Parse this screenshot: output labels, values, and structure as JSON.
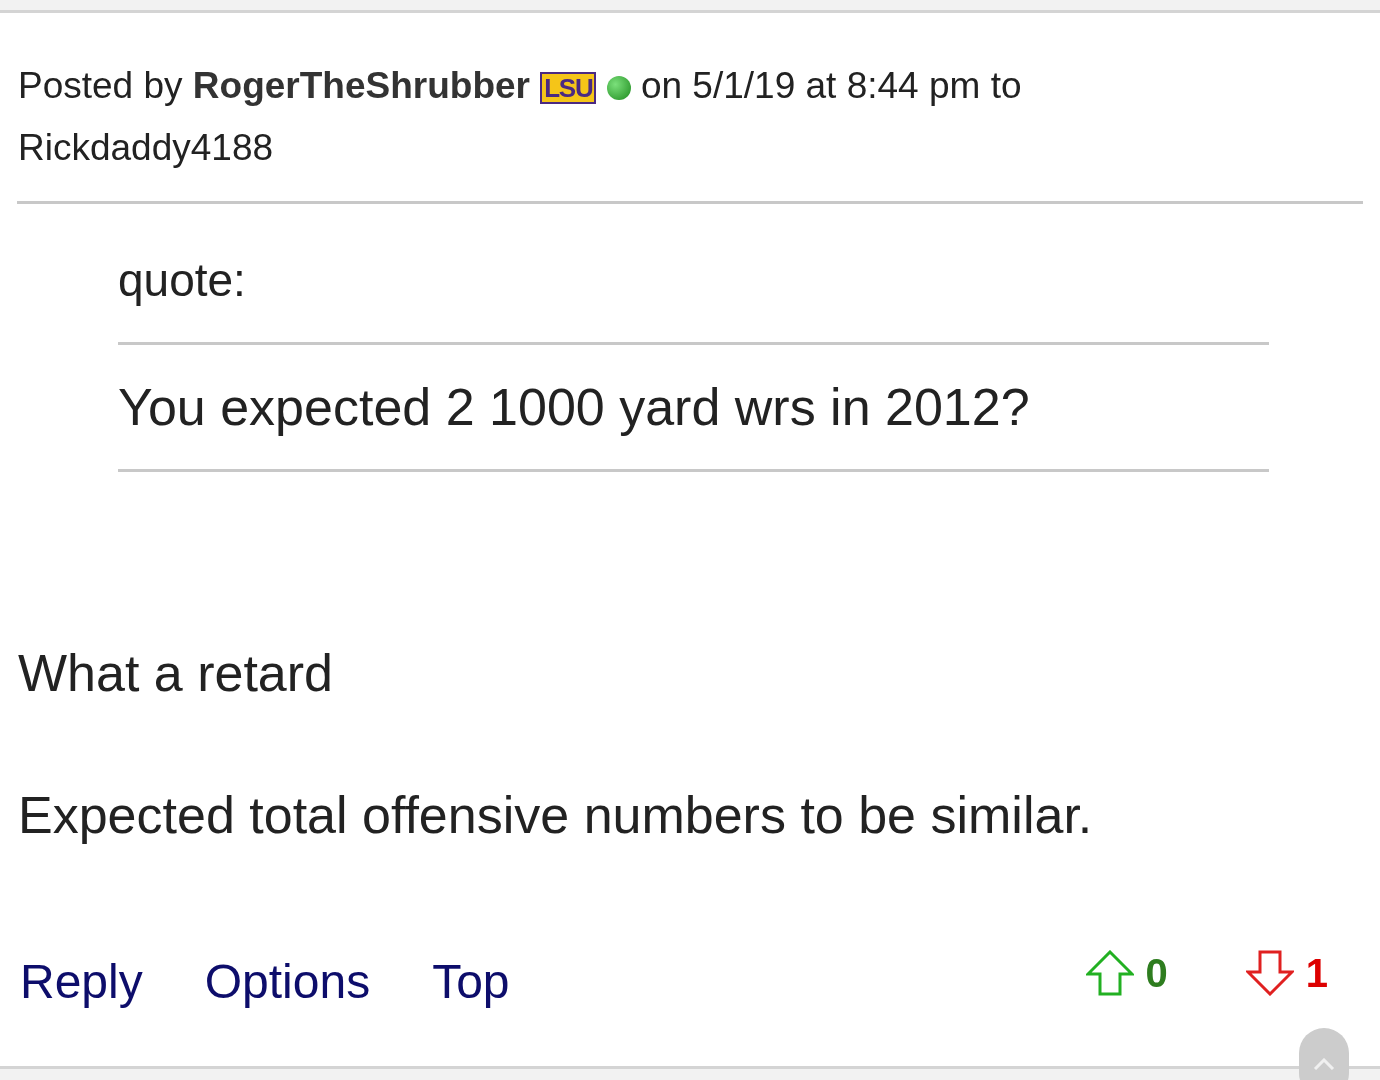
{
  "post": {
    "prefix": "Posted by",
    "author": "RogerTheShrubber",
    "team_badge": "LSU",
    "online": true,
    "suffix": "on 5/1/19 at 8:44 pm to",
    "recipient": "Rickdaddy4188"
  },
  "quote": {
    "label": "quote:",
    "text": "You expected 2 1000 yard wrs in 2012?"
  },
  "body": [
    "What a retard",
    "Expected total offensive numbers to be similar."
  ],
  "actions": [
    "Reply",
    "Options",
    "Top"
  ],
  "votes": {
    "up": "0",
    "down": "1"
  }
}
